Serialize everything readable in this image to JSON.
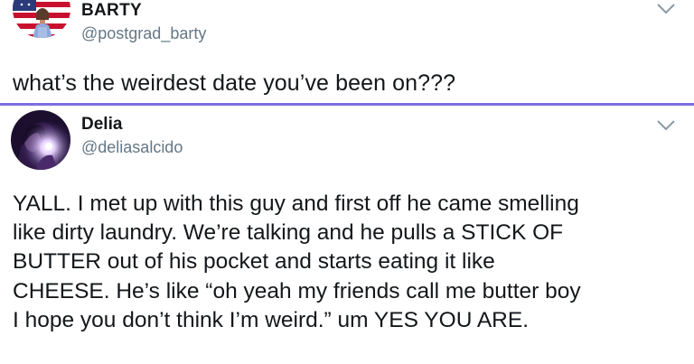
{
  "tweets": [
    {
      "display_name": "BARTY",
      "handle": "@postgrad_barty",
      "text": "what’s the weirdest date you’ve been on???"
    },
    {
      "display_name": "Delia",
      "handle": "@deliasalcido",
      "lines": [
        "YALL. I met up with this guy and first off he came smelling",
        "like dirty laundry. We’re talking and he pulls a STICK OF",
        "BUTTER out of his pocket and starts eating it like",
        "CHEESE. He’s like “oh yeah my friends call me butter boy",
        "I hope you don’t think I’m weird.” um YES YOU ARE."
      ]
    }
  ],
  "icons": {
    "menu": "chevron-down-icon",
    "avatar1": "avatar-flag-photo",
    "avatar2": "avatar-night-photo"
  },
  "colors": {
    "divider": "#7b6fe0",
    "handle": "#657786",
    "text": "#14171a"
  }
}
